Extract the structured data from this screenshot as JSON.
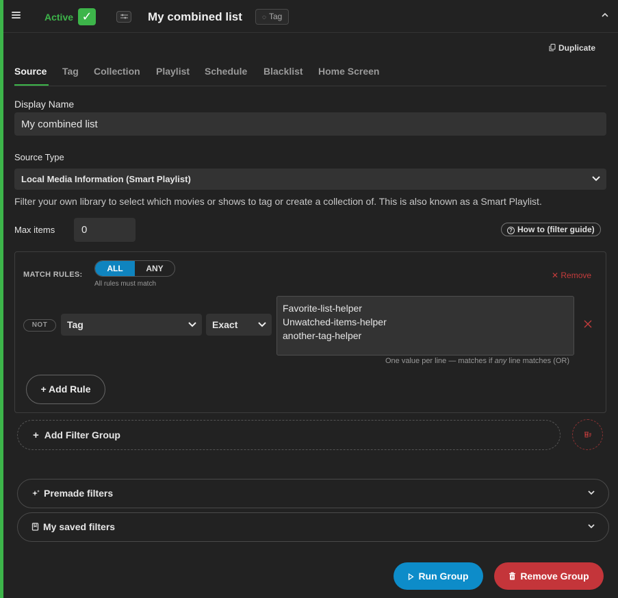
{
  "header": {
    "active_label": "Active",
    "active_check": "✓",
    "title": "My combined list",
    "tag_chip": "Tag"
  },
  "toolbar": {
    "duplicate_label": "Duplicate"
  },
  "tabs": [
    {
      "label": "Source"
    },
    {
      "label": "Tag"
    },
    {
      "label": "Collection"
    },
    {
      "label": "Playlist"
    },
    {
      "label": "Schedule"
    },
    {
      "label": "Blacklist"
    },
    {
      "label": "Home Screen"
    }
  ],
  "form": {
    "display_name_label": "Display Name",
    "display_name_value": "My combined list",
    "source_type_label": "Source Type",
    "source_type_value": "Local Media Information (Smart Playlist)",
    "source_help": "Filter your own library to select which movies or shows to tag or create a collection of. This is also known as a Smart Playlist.",
    "max_items_label": "Max items",
    "max_items_value": "0",
    "howto_label": "How to (filter guide)"
  },
  "rules": {
    "match_label": "MATCH RULES:",
    "toggle_all": "ALL",
    "toggle_any": "ANY",
    "toggle_hint": "All rules must match",
    "remove_label": "Remove",
    "not_label": "NOT",
    "field_value": "Tag",
    "operator_value": "Exact",
    "values": [
      "Favorite-list-helper",
      "Unwatched-items-helper",
      "another-tag-helper"
    ],
    "values_hint_pre": "One value per line — matches if ",
    "values_hint_em": "any",
    "values_hint_post": " line matches (OR)",
    "add_rule_label": "+ Add Rule"
  },
  "add_filter_group_label": "Add Filter Group",
  "accordions": {
    "premade": "Premade filters",
    "saved": "My saved filters"
  },
  "actions": {
    "run_label": "Run Group",
    "remove_label": "Remove Group"
  },
  "colors": {
    "accent_green": "#3db54a",
    "run_blue": "#0d8cc9",
    "danger_red": "#c4353a"
  }
}
